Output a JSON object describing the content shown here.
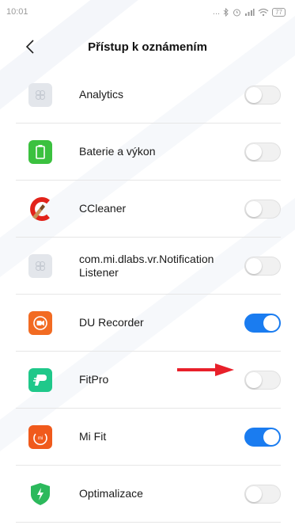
{
  "status_bar": {
    "time": "10:01",
    "signal_dots": "...",
    "battery": "77"
  },
  "header": {
    "title": "Přístup k oznámením"
  },
  "apps": [
    {
      "name": "Analytics",
      "icon": "generic-app-icon",
      "enabled": false
    },
    {
      "name": "Baterie a výkon",
      "icon": "battery-icon",
      "enabled": false
    },
    {
      "name": "CCleaner",
      "icon": "ccleaner-logo-icon",
      "enabled": false
    },
    {
      "name": "com.mi.dlabs.vr.Notification Listener",
      "icon": "generic-app-icon",
      "enabled": false
    },
    {
      "name": "DU Recorder",
      "icon": "du-recorder-icon",
      "enabled": true
    },
    {
      "name": "FitPro",
      "icon": "fitpro-icon",
      "enabled": false
    },
    {
      "name": "Mi Fit",
      "icon": "mi-fit-icon",
      "enabled": true
    },
    {
      "name": "Optimalizace",
      "icon": "shield-bolt-icon",
      "enabled": false
    }
  ],
  "colors": {
    "toggle_on": "#1a7cf0",
    "arrow": "#e8202a"
  }
}
